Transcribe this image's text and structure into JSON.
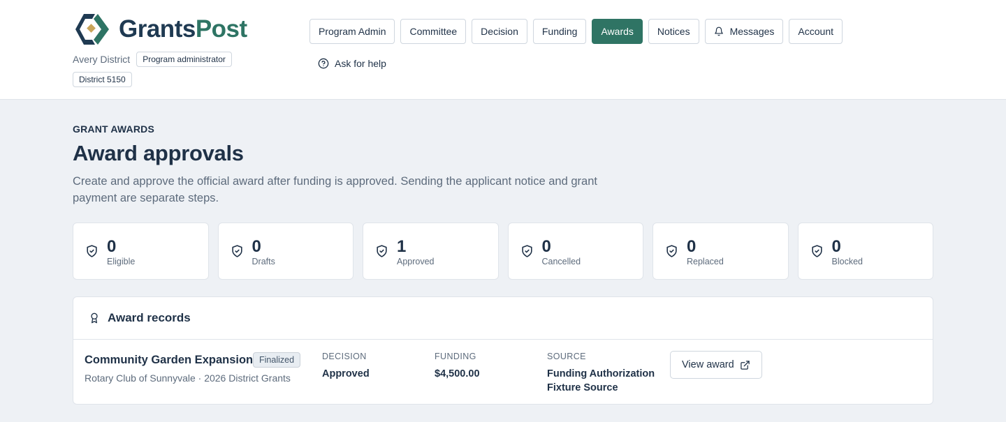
{
  "brand": {
    "name_part1": "Grants",
    "name_part2": "Post",
    "logo_icon": "grantspost-logo-icon",
    "colors": {
      "navy": "#1f3a52",
      "green": "#2e7464",
      "gold": "#c9a55a"
    }
  },
  "user": {
    "name": "Avery District",
    "role": "Program administrator",
    "district": "District 5150"
  },
  "nav": {
    "items": [
      {
        "label": "Program Admin"
      },
      {
        "label": "Committee"
      },
      {
        "label": "Decision"
      },
      {
        "label": "Funding"
      },
      {
        "label": "Awards",
        "active": true
      },
      {
        "label": "Notices"
      },
      {
        "label": "Messages",
        "icon": "bell-icon"
      },
      {
        "label": "Account"
      }
    ],
    "active_color": "#2f7464"
  },
  "help": {
    "label": "Ask for help",
    "icon": "help-circle-icon"
  },
  "page": {
    "eyebrow": "GRANT AWARDS",
    "title": "Award approvals",
    "description": "Create and approve the official award after funding is approved. Sending the applicant notice and grant payment are separate steps."
  },
  "stats": [
    {
      "value": "0",
      "label": "Eligible",
      "icon": "shield-check-icon"
    },
    {
      "value": "0",
      "label": "Drafts",
      "icon": "shield-check-icon"
    },
    {
      "value": "1",
      "label": "Approved",
      "icon": "shield-check-icon"
    },
    {
      "value": "0",
      "label": "Cancelled",
      "icon": "shield-check-icon"
    },
    {
      "value": "0",
      "label": "Replaced",
      "icon": "shield-check-icon"
    },
    {
      "value": "0",
      "label": "Blocked",
      "icon": "shield-check-icon"
    }
  ],
  "records": {
    "title": "Award records",
    "icon": "award-ribbon-icon",
    "rows": [
      {
        "name": "Community Garden Expansion",
        "status": "Finalized",
        "subtitle": "Rotary Club of Sunnyvale · 2026 District Grants",
        "decision_label": "DECISION",
        "decision_value": "Approved",
        "funding_label": "FUNDING",
        "funding_value": "$4,500.00",
        "source_label": "SOURCE",
        "source_line1": "Funding Authorization",
        "source_line2": "Fixture Source",
        "action_label": "View award",
        "action_icon": "external-link-icon"
      }
    ]
  }
}
